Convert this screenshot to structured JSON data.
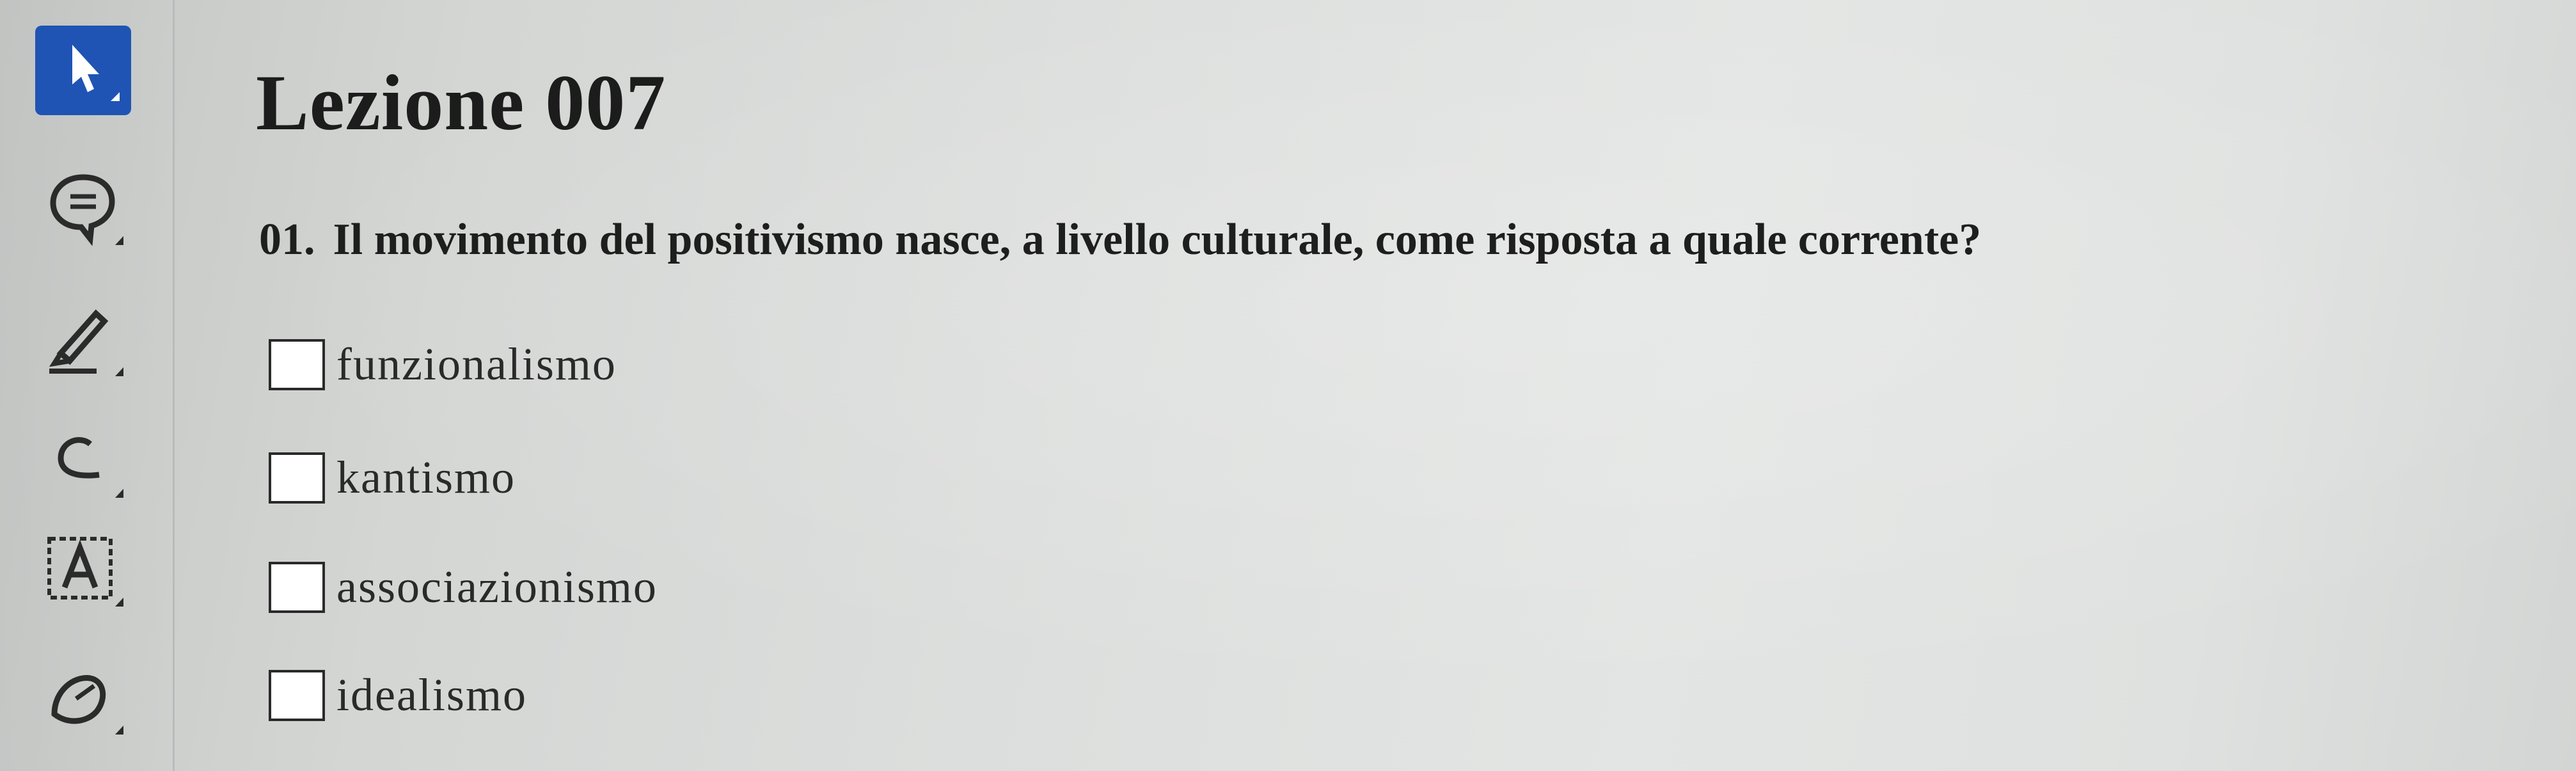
{
  "toolbar": {
    "tools": [
      {
        "icon": "select-arrow-icon",
        "active": true,
        "accent": "#1f54b4"
      },
      {
        "icon": "comment-icon",
        "active": false
      },
      {
        "icon": "highlighter-icon",
        "active": false
      },
      {
        "icon": "eraser-icon",
        "active": false
      },
      {
        "icon": "text-box-icon",
        "active": false
      },
      {
        "icon": "shape-icon",
        "active": false
      }
    ]
  },
  "lesson": {
    "title": "Lezione 007"
  },
  "question": {
    "number": "01.",
    "text": "Il movimento del positivismo nasce, a livello culturale, come risposta a quale corrente?",
    "options": [
      {
        "label": "funzionalismo",
        "checked": false
      },
      {
        "label": "kantismo",
        "checked": false
      },
      {
        "label": "associazionismo",
        "checked": false
      },
      {
        "label": "idealismo",
        "checked": false
      }
    ]
  }
}
